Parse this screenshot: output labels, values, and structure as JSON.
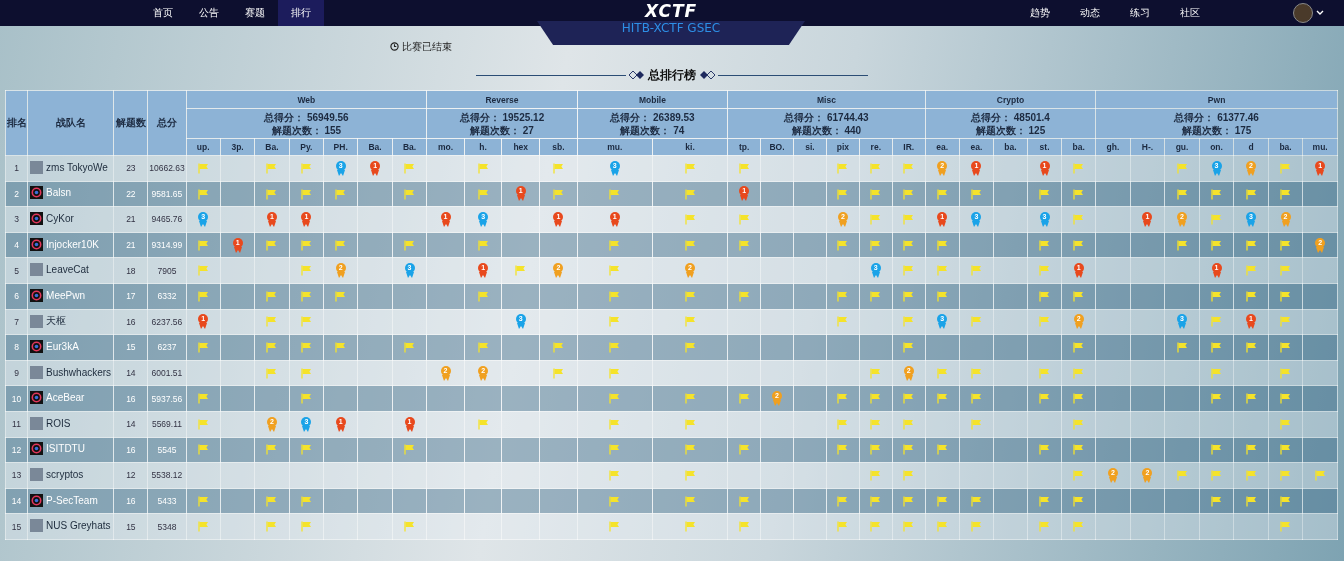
{
  "nav": {
    "left": [
      {
        "label": "首页",
        "selected": false
      },
      {
        "label": "公告",
        "selected": false
      },
      {
        "label": "赛题",
        "selected": false
      },
      {
        "label": "排行",
        "selected": true
      }
    ],
    "logo": "XCTF",
    "subtitle": "HITB-XCTF GSEC",
    "right": [
      {
        "label": "趋势"
      },
      {
        "label": "动态"
      },
      {
        "label": "练习"
      },
      {
        "label": "社区"
      }
    ]
  },
  "status": "比赛已结束",
  "title": "总排行榜",
  "table": {
    "columns": [
      "排名",
      "战队名",
      "解题数",
      "总分"
    ],
    "categories": [
      {
        "name": "Web",
        "score": "总得分： 56949.56",
        "solves": "解题次数： 155",
        "challenges": [
          "up.",
          "3p.",
          "Ba.",
          "Py.",
          "PH.",
          "Ba.",
          "Ba."
        ]
      },
      {
        "name": "Reverse",
        "score": "总得分： 19525.12",
        "solves": "解题次数： 27",
        "challenges": [
          "mo.",
          "h.",
          "hex",
          "sb."
        ]
      },
      {
        "name": "Mobile",
        "score": "总得分： 26389.53",
        "solves": "解题次数： 74",
        "challenges": [
          "mu.",
          "ki."
        ]
      },
      {
        "name": "Misc",
        "score": "总得分： 61744.43",
        "solves": "解题次数： 440",
        "challenges": [
          "tp.",
          "BO.",
          "si.",
          "pix",
          "re.",
          "IR."
        ]
      },
      {
        "name": "Crypto",
        "score": "总得分： 48501.4",
        "solves": "解题次数： 125",
        "challenges": [
          "ea.",
          "ea.",
          "ba.",
          "st.",
          "ba."
        ]
      },
      {
        "name": "Pwn",
        "score": "总得分： 61377.46",
        "solves": "解题次数： 175",
        "challenges": [
          "gh.",
          "H-.",
          "gu.",
          "on.",
          "d",
          "ba.",
          "mu."
        ]
      }
    ],
    "rows": [
      {
        "rank": "1",
        "team": "zms   TokyoWe",
        "avatar": {
          "kind": "picture"
        },
        "solved": "23",
        "total": "10662.63",
        "cells": [
          {
            "kind": "flag"
          },
          {
            "kind": "none"
          },
          {
            "kind": "flag"
          },
          {
            "kind": "flag"
          },
          {
            "kind": "medal",
            "place": "3"
          },
          {
            "kind": "medal",
            "place": "1"
          },
          {
            "kind": "flag"
          },
          {
            "kind": "none"
          },
          {
            "kind": "flag"
          },
          {
            "kind": "none"
          },
          {
            "kind": "flag"
          },
          {
            "kind": "medal",
            "place": "3"
          },
          {
            "kind": "flag"
          },
          {
            "kind": "flag"
          },
          {
            "kind": "none"
          },
          {
            "kind": "none"
          },
          {
            "kind": "flag"
          },
          {
            "kind": "flag"
          },
          {
            "kind": "flag"
          },
          {
            "kind": "medal",
            "place": "2"
          },
          {
            "kind": "medal",
            "place": "1"
          },
          {
            "kind": "none"
          },
          {
            "kind": "medal",
            "place": "1"
          },
          {
            "kind": "flag"
          },
          {
            "kind": "none"
          },
          {
            "kind": "none"
          },
          {
            "kind": "flag"
          },
          {
            "kind": "medal",
            "place": "3"
          },
          {
            "kind": "medal",
            "place": "2"
          },
          {
            "kind": "flag"
          },
          {
            "kind": "medal",
            "place": "1"
          }
        ]
      },
      {
        "rank": "2",
        "team": "Balsn",
        "avatar": {
          "kind": "default"
        },
        "solved": "22",
        "total": "9581.65",
        "cells": [
          {
            "kind": "flag"
          },
          {
            "kind": "none"
          },
          {
            "kind": "flag"
          },
          {
            "kind": "flag"
          },
          {
            "kind": "flag"
          },
          {
            "kind": "none"
          },
          {
            "kind": "flag"
          },
          {
            "kind": "none"
          },
          {
            "kind": "flag"
          },
          {
            "kind": "medal",
            "place": "1"
          },
          {
            "kind": "flag"
          },
          {
            "kind": "flag"
          },
          {
            "kind": "flag"
          },
          {
            "kind": "medal",
            "place": "1"
          },
          {
            "kind": "none"
          },
          {
            "kind": "none"
          },
          {
            "kind": "flag"
          },
          {
            "kind": "flag"
          },
          {
            "kind": "flag"
          },
          {
            "kind": "flag"
          },
          {
            "kind": "flag"
          },
          {
            "kind": "none"
          },
          {
            "kind": "flag"
          },
          {
            "kind": "flag"
          },
          {
            "kind": "none"
          },
          {
            "kind": "none"
          },
          {
            "kind": "flag"
          },
          {
            "kind": "flag"
          },
          {
            "kind": "flag"
          },
          {
            "kind": "flag"
          },
          {
            "kind": "none"
          }
        ]
      },
      {
        "rank": "3",
        "team": "CyKor",
        "avatar": {
          "kind": "default"
        },
        "solved": "21",
        "total": "9465.76",
        "cells": [
          {
            "kind": "medal",
            "place": "3"
          },
          {
            "kind": "none"
          },
          {
            "kind": "medal",
            "place": "1"
          },
          {
            "kind": "medal",
            "place": "1"
          },
          {
            "kind": "none"
          },
          {
            "kind": "none"
          },
          {
            "kind": "none"
          },
          {
            "kind": "medal",
            "place": "1"
          },
          {
            "kind": "medal",
            "place": "3"
          },
          {
            "kind": "none"
          },
          {
            "kind": "medal",
            "place": "1"
          },
          {
            "kind": "medal",
            "place": "1"
          },
          {
            "kind": "flag"
          },
          {
            "kind": "flag"
          },
          {
            "kind": "none"
          },
          {
            "kind": "none"
          },
          {
            "kind": "medal",
            "place": "2"
          },
          {
            "kind": "flag"
          },
          {
            "kind": "flag"
          },
          {
            "kind": "medal",
            "place": "1"
          },
          {
            "kind": "medal",
            "place": "3"
          },
          {
            "kind": "none"
          },
          {
            "kind": "medal",
            "place": "3"
          },
          {
            "kind": "flag"
          },
          {
            "kind": "none"
          },
          {
            "kind": "medal",
            "place": "1"
          },
          {
            "kind": "medal",
            "place": "2"
          },
          {
            "kind": "flag"
          },
          {
            "kind": "medal",
            "place": "3"
          },
          {
            "kind": "medal",
            "place": "2"
          },
          {
            "kind": "none"
          }
        ]
      },
      {
        "rank": "4",
        "team": "Injocker10K",
        "avatar": {
          "kind": "default"
        },
        "solved": "21",
        "total": "9314.99",
        "cells": [
          {
            "kind": "flag"
          },
          {
            "kind": "medal",
            "place": "1"
          },
          {
            "kind": "flag"
          },
          {
            "kind": "flag"
          },
          {
            "kind": "flag"
          },
          {
            "kind": "none"
          },
          {
            "kind": "flag"
          },
          {
            "kind": "none"
          },
          {
            "kind": "flag"
          },
          {
            "kind": "none"
          },
          {
            "kind": "none"
          },
          {
            "kind": "flag"
          },
          {
            "kind": "flag"
          },
          {
            "kind": "flag"
          },
          {
            "kind": "none"
          },
          {
            "kind": "none"
          },
          {
            "kind": "flag"
          },
          {
            "kind": "flag"
          },
          {
            "kind": "flag"
          },
          {
            "kind": "flag"
          },
          {
            "kind": "none"
          },
          {
            "kind": "none"
          },
          {
            "kind": "flag"
          },
          {
            "kind": "flag"
          },
          {
            "kind": "none"
          },
          {
            "kind": "none"
          },
          {
            "kind": "flag"
          },
          {
            "kind": "flag"
          },
          {
            "kind": "flag"
          },
          {
            "kind": "flag"
          },
          {
            "kind": "medal",
            "place": "2"
          }
        ]
      },
      {
        "rank": "5",
        "team": "LeaveCat",
        "avatar": {
          "kind": "picture"
        },
        "solved": "18",
        "total": "7905",
        "cells": [
          {
            "kind": "flag"
          },
          {
            "kind": "none"
          },
          {
            "kind": "none"
          },
          {
            "kind": "flag"
          },
          {
            "kind": "medal",
            "place": "2"
          },
          {
            "kind": "none"
          },
          {
            "kind": "medal",
            "place": "3"
          },
          {
            "kind": "none"
          },
          {
            "kind": "medal",
            "place": "1"
          },
          {
            "kind": "flag"
          },
          {
            "kind": "medal",
            "place": "2"
          },
          {
            "kind": "flag"
          },
          {
            "kind": "medal",
            "place": "2"
          },
          {
            "kind": "none"
          },
          {
            "kind": "none"
          },
          {
            "kind": "none"
          },
          {
            "kind": "none"
          },
          {
            "kind": "medal",
            "place": "3"
          },
          {
            "kind": "flag"
          },
          {
            "kind": "flag"
          },
          {
            "kind": "flag"
          },
          {
            "kind": "none"
          },
          {
            "kind": "flag"
          },
          {
            "kind": "medal",
            "place": "1"
          },
          {
            "kind": "none"
          },
          {
            "kind": "none"
          },
          {
            "kind": "none"
          },
          {
            "kind": "medal",
            "place": "1"
          },
          {
            "kind": "flag"
          },
          {
            "kind": "flag"
          },
          {
            "kind": "none"
          }
        ]
      },
      {
        "rank": "6",
        "team": "MeePwn",
        "avatar": {
          "kind": "default"
        },
        "solved": "17",
        "total": "6332",
        "cells": [
          {
            "kind": "flag"
          },
          {
            "kind": "none"
          },
          {
            "kind": "flag"
          },
          {
            "kind": "flag"
          },
          {
            "kind": "flag"
          },
          {
            "kind": "none"
          },
          {
            "kind": "none"
          },
          {
            "kind": "none"
          },
          {
            "kind": "flag"
          },
          {
            "kind": "none"
          },
          {
            "kind": "none"
          },
          {
            "kind": "flag"
          },
          {
            "kind": "flag"
          },
          {
            "kind": "flag"
          },
          {
            "kind": "none"
          },
          {
            "kind": "none"
          },
          {
            "kind": "flag"
          },
          {
            "kind": "flag"
          },
          {
            "kind": "flag"
          },
          {
            "kind": "flag"
          },
          {
            "kind": "none"
          },
          {
            "kind": "none"
          },
          {
            "kind": "flag"
          },
          {
            "kind": "flag"
          },
          {
            "kind": "none"
          },
          {
            "kind": "none"
          },
          {
            "kind": "none"
          },
          {
            "kind": "flag"
          },
          {
            "kind": "flag"
          },
          {
            "kind": "flag"
          },
          {
            "kind": "none"
          }
        ]
      },
      {
        "rank": "7",
        "team": "天枢",
        "avatar": {
          "kind": "picture"
        },
        "solved": "16",
        "total": "6237.56",
        "cells": [
          {
            "kind": "medal",
            "place": "1"
          },
          {
            "kind": "none"
          },
          {
            "kind": "flag"
          },
          {
            "kind": "flag"
          },
          {
            "kind": "none"
          },
          {
            "kind": "none"
          },
          {
            "kind": "none"
          },
          {
            "kind": "none"
          },
          {
            "kind": "none"
          },
          {
            "kind": "medal",
            "place": "3"
          },
          {
            "kind": "none"
          },
          {
            "kind": "flag"
          },
          {
            "kind": "flag"
          },
          {
            "kind": "none"
          },
          {
            "kind": "none"
          },
          {
            "kind": "none"
          },
          {
            "kind": "flag"
          },
          {
            "kind": "none"
          },
          {
            "kind": "flag"
          },
          {
            "kind": "medal",
            "place": "3"
          },
          {
            "kind": "flag"
          },
          {
            "kind": "none"
          },
          {
            "kind": "flag"
          },
          {
            "kind": "medal",
            "place": "2"
          },
          {
            "kind": "none"
          },
          {
            "kind": "none"
          },
          {
            "kind": "medal",
            "place": "3"
          },
          {
            "kind": "flag"
          },
          {
            "kind": "medal",
            "place": "1"
          },
          {
            "kind": "flag"
          },
          {
            "kind": "none"
          }
        ]
      },
      {
        "rank": "8",
        "team": "Eur3kA",
        "avatar": {
          "kind": "default"
        },
        "solved": "15",
        "total": "6237",
        "cells": [
          {
            "kind": "flag"
          },
          {
            "kind": "none"
          },
          {
            "kind": "flag"
          },
          {
            "kind": "flag"
          },
          {
            "kind": "flag"
          },
          {
            "kind": "none"
          },
          {
            "kind": "flag"
          },
          {
            "kind": "none"
          },
          {
            "kind": "flag"
          },
          {
            "kind": "none"
          },
          {
            "kind": "flag"
          },
          {
            "kind": "flag"
          },
          {
            "kind": "flag"
          },
          {
            "kind": "none"
          },
          {
            "kind": "none"
          },
          {
            "kind": "none"
          },
          {
            "kind": "none"
          },
          {
            "kind": "none"
          },
          {
            "kind": "flag"
          },
          {
            "kind": "none"
          },
          {
            "kind": "none"
          },
          {
            "kind": "none"
          },
          {
            "kind": "none"
          },
          {
            "kind": "flag"
          },
          {
            "kind": "none"
          },
          {
            "kind": "none"
          },
          {
            "kind": "flag"
          },
          {
            "kind": "flag"
          },
          {
            "kind": "flag"
          },
          {
            "kind": "flag"
          },
          {
            "kind": "none"
          }
        ]
      },
      {
        "rank": "9",
        "team": "Bushwhackers",
        "avatar": {
          "kind": "picture"
        },
        "solved": "14",
        "total": "6001.51",
        "cells": [
          {
            "kind": "none"
          },
          {
            "kind": "none"
          },
          {
            "kind": "flag"
          },
          {
            "kind": "flag"
          },
          {
            "kind": "none"
          },
          {
            "kind": "none"
          },
          {
            "kind": "none"
          },
          {
            "kind": "medal",
            "place": "2"
          },
          {
            "kind": "medal",
            "place": "2"
          },
          {
            "kind": "none"
          },
          {
            "kind": "flag"
          },
          {
            "kind": "flag"
          },
          {
            "kind": "none"
          },
          {
            "kind": "none"
          },
          {
            "kind": "none"
          },
          {
            "kind": "none"
          },
          {
            "kind": "none"
          },
          {
            "kind": "flag"
          },
          {
            "kind": "medal",
            "place": "2"
          },
          {
            "kind": "flag"
          },
          {
            "kind": "flag"
          },
          {
            "kind": "none"
          },
          {
            "kind": "flag"
          },
          {
            "kind": "flag"
          },
          {
            "kind": "none"
          },
          {
            "kind": "none"
          },
          {
            "kind": "none"
          },
          {
            "kind": "flag"
          },
          {
            "kind": "none"
          },
          {
            "kind": "flag"
          },
          {
            "kind": "none"
          }
        ]
      },
      {
        "rank": "10",
        "team": "AceBear",
        "avatar": {
          "kind": "default"
        },
        "solved": "16",
        "total": "5937.56",
        "cells": [
          {
            "kind": "flag"
          },
          {
            "kind": "none"
          },
          {
            "kind": "none"
          },
          {
            "kind": "flag"
          },
          {
            "kind": "none"
          },
          {
            "kind": "none"
          },
          {
            "kind": "none"
          },
          {
            "kind": "none"
          },
          {
            "kind": "none"
          },
          {
            "kind": "none"
          },
          {
            "kind": "none"
          },
          {
            "kind": "flag"
          },
          {
            "kind": "flag"
          },
          {
            "kind": "flag"
          },
          {
            "kind": "medal",
            "place": "2"
          },
          {
            "kind": "none"
          },
          {
            "kind": "flag"
          },
          {
            "kind": "flag"
          },
          {
            "kind": "flag"
          },
          {
            "kind": "flag"
          },
          {
            "kind": "flag"
          },
          {
            "kind": "none"
          },
          {
            "kind": "flag"
          },
          {
            "kind": "flag"
          },
          {
            "kind": "none"
          },
          {
            "kind": "none"
          },
          {
            "kind": "none"
          },
          {
            "kind": "flag"
          },
          {
            "kind": "flag"
          },
          {
            "kind": "flag"
          },
          {
            "kind": "none"
          }
        ]
      },
      {
        "rank": "11",
        "team": "ROIS",
        "avatar": {
          "kind": "picture"
        },
        "solved": "14",
        "total": "5569.11",
        "cells": [
          {
            "kind": "flag"
          },
          {
            "kind": "none"
          },
          {
            "kind": "medal",
            "place": "2"
          },
          {
            "kind": "medal",
            "place": "3"
          },
          {
            "kind": "medal",
            "place": "1"
          },
          {
            "kind": "none"
          },
          {
            "kind": "medal",
            "place": "1"
          },
          {
            "kind": "none"
          },
          {
            "kind": "flag"
          },
          {
            "kind": "none"
          },
          {
            "kind": "none"
          },
          {
            "kind": "flag"
          },
          {
            "kind": "flag"
          },
          {
            "kind": "none"
          },
          {
            "kind": "none"
          },
          {
            "kind": "none"
          },
          {
            "kind": "flag"
          },
          {
            "kind": "flag"
          },
          {
            "kind": "flag"
          },
          {
            "kind": "none"
          },
          {
            "kind": "flag"
          },
          {
            "kind": "none"
          },
          {
            "kind": "none"
          },
          {
            "kind": "flag"
          },
          {
            "kind": "none"
          },
          {
            "kind": "none"
          },
          {
            "kind": "none"
          },
          {
            "kind": "none"
          },
          {
            "kind": "none"
          },
          {
            "kind": "flag"
          },
          {
            "kind": "none"
          }
        ]
      },
      {
        "rank": "12",
        "team": "ISITDTU",
        "avatar": {
          "kind": "default"
        },
        "solved": "16",
        "total": "5545",
        "cells": [
          {
            "kind": "flag"
          },
          {
            "kind": "none"
          },
          {
            "kind": "flag"
          },
          {
            "kind": "flag"
          },
          {
            "kind": "none"
          },
          {
            "kind": "none"
          },
          {
            "kind": "flag"
          },
          {
            "kind": "none"
          },
          {
            "kind": "none"
          },
          {
            "kind": "none"
          },
          {
            "kind": "none"
          },
          {
            "kind": "flag"
          },
          {
            "kind": "flag"
          },
          {
            "kind": "flag"
          },
          {
            "kind": "none"
          },
          {
            "kind": "none"
          },
          {
            "kind": "flag"
          },
          {
            "kind": "flag"
          },
          {
            "kind": "flag"
          },
          {
            "kind": "flag"
          },
          {
            "kind": "none"
          },
          {
            "kind": "none"
          },
          {
            "kind": "flag"
          },
          {
            "kind": "flag"
          },
          {
            "kind": "none"
          },
          {
            "kind": "none"
          },
          {
            "kind": "none"
          },
          {
            "kind": "flag"
          },
          {
            "kind": "flag"
          },
          {
            "kind": "flag"
          },
          {
            "kind": "none"
          }
        ]
      },
      {
        "rank": "13",
        "team": "scryptos",
        "avatar": {
          "kind": "picture"
        },
        "solved": "12",
        "total": "5538.12",
        "cells": [
          {
            "kind": "none"
          },
          {
            "kind": "none"
          },
          {
            "kind": "none"
          },
          {
            "kind": "none"
          },
          {
            "kind": "none"
          },
          {
            "kind": "none"
          },
          {
            "kind": "none"
          },
          {
            "kind": "none"
          },
          {
            "kind": "none"
          },
          {
            "kind": "none"
          },
          {
            "kind": "none"
          },
          {
            "kind": "flag"
          },
          {
            "kind": "flag"
          },
          {
            "kind": "none"
          },
          {
            "kind": "none"
          },
          {
            "kind": "none"
          },
          {
            "kind": "none"
          },
          {
            "kind": "flag"
          },
          {
            "kind": "flag"
          },
          {
            "kind": "none"
          },
          {
            "kind": "none"
          },
          {
            "kind": "none"
          },
          {
            "kind": "none"
          },
          {
            "kind": "flag"
          },
          {
            "kind": "medal",
            "place": "2"
          },
          {
            "kind": "medal",
            "place": "2"
          },
          {
            "kind": "flag"
          },
          {
            "kind": "flag"
          },
          {
            "kind": "flag"
          },
          {
            "kind": "flag"
          },
          {
            "kind": "flag"
          }
        ]
      },
      {
        "rank": "14",
        "team": "P-SecTeam",
        "avatar": {
          "kind": "default"
        },
        "solved": "16",
        "total": "5433",
        "cells": [
          {
            "kind": "flag"
          },
          {
            "kind": "none"
          },
          {
            "kind": "flag"
          },
          {
            "kind": "flag"
          },
          {
            "kind": "none"
          },
          {
            "kind": "none"
          },
          {
            "kind": "none"
          },
          {
            "kind": "none"
          },
          {
            "kind": "none"
          },
          {
            "kind": "none"
          },
          {
            "kind": "none"
          },
          {
            "kind": "flag"
          },
          {
            "kind": "flag"
          },
          {
            "kind": "flag"
          },
          {
            "kind": "none"
          },
          {
            "kind": "none"
          },
          {
            "kind": "flag"
          },
          {
            "kind": "flag"
          },
          {
            "kind": "flag"
          },
          {
            "kind": "flag"
          },
          {
            "kind": "flag"
          },
          {
            "kind": "none"
          },
          {
            "kind": "flag"
          },
          {
            "kind": "flag"
          },
          {
            "kind": "none"
          },
          {
            "kind": "none"
          },
          {
            "kind": "none"
          },
          {
            "kind": "flag"
          },
          {
            "kind": "flag"
          },
          {
            "kind": "flag"
          },
          {
            "kind": "none"
          }
        ]
      },
      {
        "rank": "15",
        "team": "NUS Greyhats",
        "avatar": {
          "kind": "picture"
        },
        "solved": "15",
        "total": "5348",
        "cells": [
          {
            "kind": "flag"
          },
          {
            "kind": "none"
          },
          {
            "kind": "flag"
          },
          {
            "kind": "flag"
          },
          {
            "kind": "none"
          },
          {
            "kind": "none"
          },
          {
            "kind": "flag"
          },
          {
            "kind": "none"
          },
          {
            "kind": "none"
          },
          {
            "kind": "none"
          },
          {
            "kind": "none"
          },
          {
            "kind": "flag"
          },
          {
            "kind": "flag"
          },
          {
            "kind": "flag"
          },
          {
            "kind": "none"
          },
          {
            "kind": "none"
          },
          {
            "kind": "flag"
          },
          {
            "kind": "flag"
          },
          {
            "kind": "flag"
          },
          {
            "kind": "flag"
          },
          {
            "kind": "flag"
          },
          {
            "kind": "none"
          },
          {
            "kind": "flag"
          },
          {
            "kind": "flag"
          },
          {
            "kind": "none"
          },
          {
            "kind": "none"
          },
          {
            "kind": "none"
          },
          {
            "kind": "none"
          },
          {
            "kind": "none"
          },
          {
            "kind": "flag"
          },
          {
            "kind": "none"
          }
        ]
      }
    ]
  }
}
